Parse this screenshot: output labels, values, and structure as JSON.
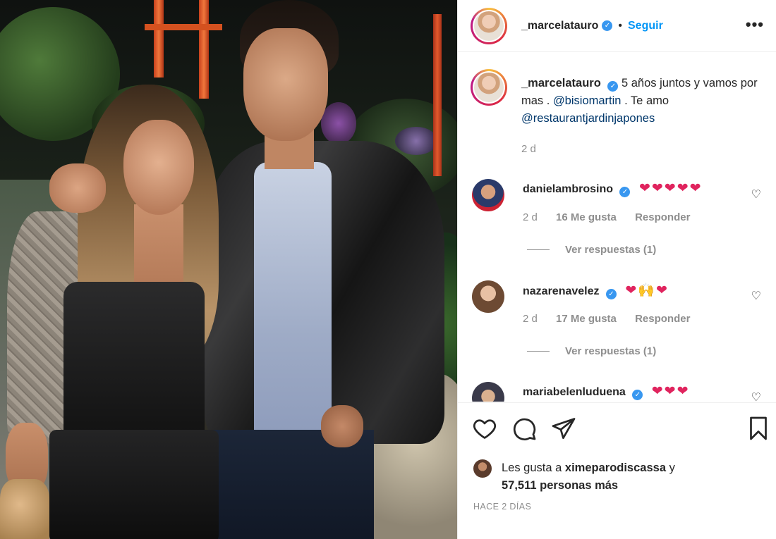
{
  "post": {
    "username": "_marcelatauro",
    "follow_label": "Seguir",
    "caption": {
      "username": "_marcelatauro",
      "text_before": "5 años juntos y vamos por mas .",
      "mention1": "@bisiomartin",
      "text_middle": ". Te amo",
      "mention2": "@restaurantjardinjapones",
      "time": "2 d"
    },
    "comments": [
      {
        "username": "danielambrosino",
        "text": "❤❤❤❤❤",
        "time": "2 d",
        "likes": "16 Me gusta",
        "reply_label": "Responder",
        "view_replies": "Ver respuestas (1)"
      },
      {
        "username": "nazarenavelez",
        "text": "❤🙌❤",
        "time": "2 d",
        "likes": "17 Me gusta",
        "reply_label": "Responder",
        "view_replies": "Ver respuestas (1)"
      },
      {
        "username": "mariabelenluduena",
        "text": "❤❤❤"
      }
    ],
    "likes": {
      "prefix": "Les gusta a",
      "first_user": "ximeparodiscassa",
      "connector": "y",
      "others": "57,511 personas más"
    },
    "posted_ago": "HACE 2 DÍAS"
  },
  "icons": {
    "more": "more-options-icon",
    "like": "heart-icon",
    "comment": "comment-icon",
    "share": "share-icon",
    "save": "bookmark-icon",
    "verified": "verified-badge-icon"
  },
  "colors": {
    "link": "#0095f6",
    "mention": "#00376b",
    "verified": "#3897f0",
    "heart": "#e0245e",
    "muted": "#8e8e8e"
  }
}
